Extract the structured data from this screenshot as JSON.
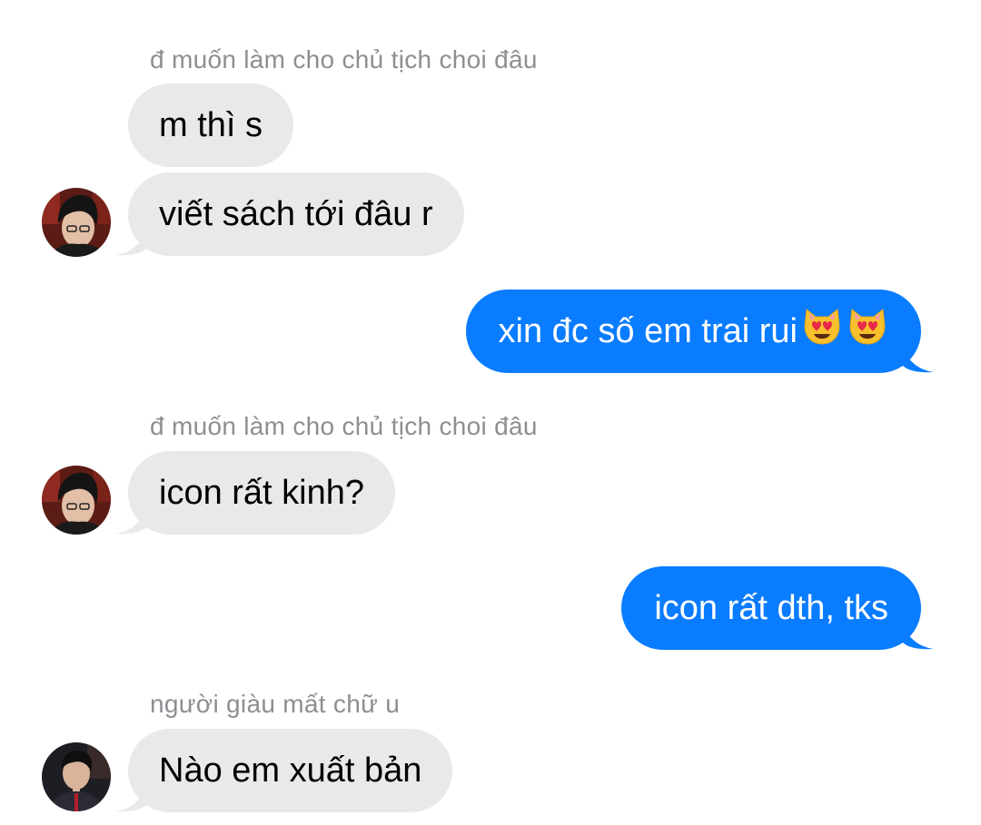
{
  "conversation": {
    "groups": [
      {
        "sender": "đ muốn làm cho chủ tịch choi đâu",
        "messages": [
          "m thì s",
          "viết sách tới đâu r"
        ]
      },
      {
        "sender": "đ muốn làm cho chủ tịch choi đâu",
        "messages": [
          "icon rất kinh?"
        ]
      },
      {
        "sender": "người giàu mất chữ u",
        "messages": [
          "Nào em xuất bản"
        ]
      }
    ],
    "outgoing": [
      {
        "text": "xin đc số em trai rui",
        "emoji": [
          "heart-eyes-cat-icon",
          "heart-eyes-cat-icon"
        ]
      },
      {
        "text": "icon rất dth, tks"
      }
    ]
  },
  "colors": {
    "incoming_bubble": "#e9e9eb",
    "outgoing_bubble": "#0a7cff",
    "sender_name": "#8e8e93"
  }
}
